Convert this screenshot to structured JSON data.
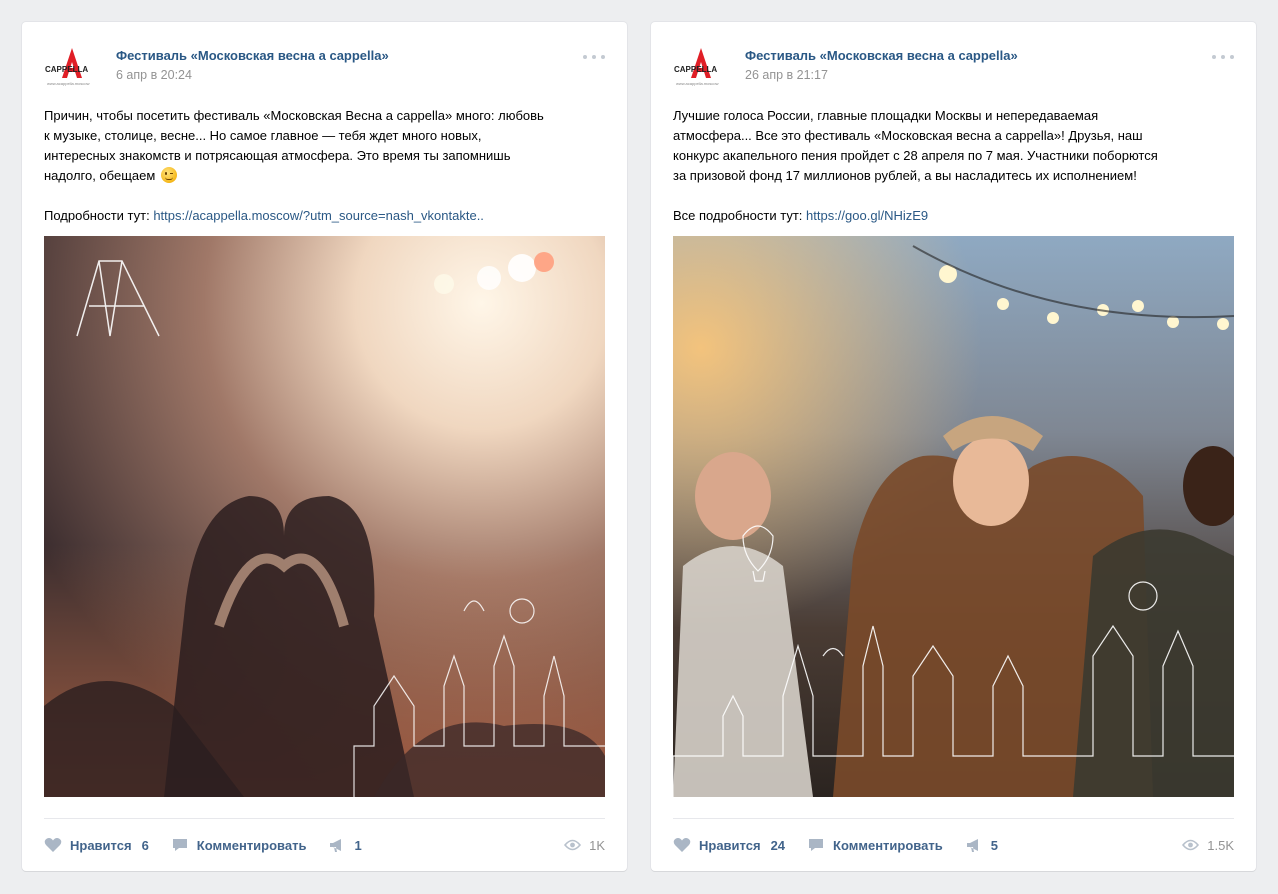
{
  "colors": {
    "link": "#2a5885",
    "action": "#42648b",
    "muted": "#939393",
    "bg": "#edeef0",
    "logo_red": "#e01e26"
  },
  "logo": {
    "brand": "A CAPPELLA",
    "site": "www.acappella.moscow"
  },
  "posts": [
    {
      "author": "Фестиваль «Московская весна a cappella»",
      "date": "6 апр в 20:24",
      "text": {
        "line1": "Причин, чтобы посетить фестиваль «Московская Весна a cappella» много: любовь",
        "line2": "к музыке, столице, весне... Но самое главное — тебя ждет много новых,",
        "line3": "интересных знакомств и потрясающая атмосфера. Это время ты запомнишь",
        "line4": "надолго, обещаем",
        "more_label": "Подробности тут:",
        "link": "https://acappella.moscow/?utm_source=nash_vkontakte.."
      },
      "emoji": "winking-face",
      "image": "concert-crowd-heart-hands-moscow-skyline",
      "likes_label": "Нравится",
      "likes": "6",
      "comment_label": "Комментировать",
      "shares": "1",
      "views": "1K"
    },
    {
      "author": "Фестиваль «Московская весна a cappella»",
      "date": "26 апр в 21:17",
      "text": {
        "line1": "Лучшие голоса России, главные площадки Москвы и непередаваемая",
        "line2": "атмосфера... Все это фестиваль «Московская весна a cappella»! Друзья, наш",
        "line3": "конкурс акапельного пения пройдет с 28 апреля по 7 мая. Участники поборются",
        "line4": "за призовой фонд 17 миллионов рублей, а вы насладитесь их исполнением!",
        "more_label": "Все подробности тут:",
        "link": "https://goo.gl/NHizE9"
      },
      "image": "rooftop-party-dancing-moscow-skyline",
      "likes_label": "Нравится",
      "likes": "24",
      "comment_label": "Комментировать",
      "shares": "5",
      "views": "1.5K"
    }
  ]
}
